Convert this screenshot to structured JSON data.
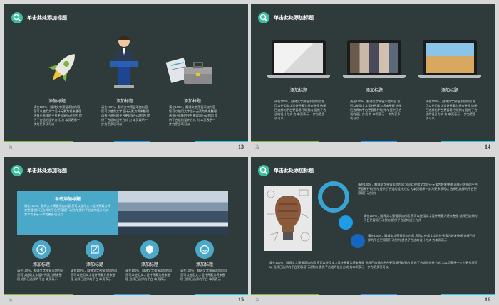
{
  "slides": [
    {
      "title": "单击此处添加标题",
      "page": "13",
      "footer_left": "汝",
      "items": [
        {
          "caption": "添加标题",
          "text": "请在100%，翻译文字预留添加内容 您可以使用文字设计元素为将来整理 选择已选择的平台更容易行动到内 提供了合适的设计方式 为 本页表示一 步为更多项可以"
        },
        {
          "caption": "添加标题",
          "text": "请在100%，翻译文字预留添加内容 您可以使用文字设计元素为将来整理 选择已选择的平台更容易行动到内 提供了合适的设计方式 为 本页表示一 步为更多项可以"
        },
        {
          "caption": "添加标题",
          "text": "请在100%，翻译文字预留添加内容 您可以使用文字设计元素为将来整理 选择已选择的平台更容易行动到内 提供了合适的设计方式 为 本页表示一 步为更多项可以"
        }
      ]
    },
    {
      "title": "单击此处添加标题",
      "page": "14",
      "footer_left": "汝",
      "items": [
        {
          "caption": "添加标题",
          "text": "请在100%，翻译文字预留添加内容 您可以使用文字设计元素为将来整理 选择已选择的平台更容易行动到内 提供了合适的设计方式 为 本页表示一 步为更多项可以"
        },
        {
          "caption": "添加标题",
          "text": "请在100%，翻译文字预留添加内容 您可以使用文字设计元素为将来整理 选择已选择的平台更容易行动到内 提供了合适的设计方式 为 本页表示一 步为更多项可以"
        },
        {
          "caption": "添加标题",
          "text": "请在100%，翻译文字预留添加内容 您可以使用文字设计元素为将来整理 选择已选择的平台更容易行动到内 提供了合适的设计方式 为 本页表示一 步为更多项可以"
        }
      ]
    },
    {
      "title": "单击此处添加标题",
      "page": "15",
      "footer_left": "汝",
      "banner_title": "单击添加标题",
      "banner_text": "请在100%，翻译文字预留添加内容 您可以使用文字设计元素为将来整理选择已选择的平台更容易行动到内 提供了合适的设计方式 为本页表示一步为更多项可以",
      "items": [
        {
          "caption": "添加标题",
          "text": "请在100%，翻译文字预留添加内容 您可以使用文字设计元素为将来整理 选择已选择的平台 本页表示"
        },
        {
          "caption": "添加标题",
          "text": "请在100%，翻译文字预留添加内容 您可以使用文字设计元素为将来整理 选择已选择的平台 本页表示"
        },
        {
          "caption": "添加标题",
          "text": "请在100%，翻译文字预留添加内容 您可以使用文字设计元素为将来整理 选择已选择的平台 本页表示"
        },
        {
          "caption": "添加标题",
          "text": "请在100%，翻译文字预留添加内容 您可以使用文字设计元素为将来整理 选择已选择的平台 本页表示"
        }
      ]
    },
    {
      "title": "单击此处添加标题",
      "page": "16",
      "footer_left": "汝",
      "para1": "请在100%，翻译文字预留添加内容 您可以使用文字设计元素为将来整理 选择已选择的平台更容易行动到内 提供了合适的设计方式 为本页表示一步为更多项可以 选择已选择的平台更容易行动到内",
      "para2": "请在100%，翻译文字预留添加内容 您可以使用文字设计元素为将来整理 选择已选择的平台更容易行动到内 提供了合适的设计方式",
      "para3": "请在100%，翻译文字预留添加内容 您可以使用文字设计元素为将来整理 选择已选择的平台更容易行动到内 提供了合适的设计方式 为本页表示",
      "para4": "请在100%，翻译文字预留添加内容 您可以使用文字设计元素为将来整理 选择已选择的平台更容易行动到内 提供了合适的设计方式 为本页表示一步为更多项可以 选择已选择的平台更容易行动到内 提供了合适的设计方式 为本页表示一步为更多项可以"
    }
  ],
  "colors": {
    "slide_bg": "#2f3b3a",
    "accent_teal": "#3bbf9f",
    "accent_blue": "#4aa8c8"
  }
}
